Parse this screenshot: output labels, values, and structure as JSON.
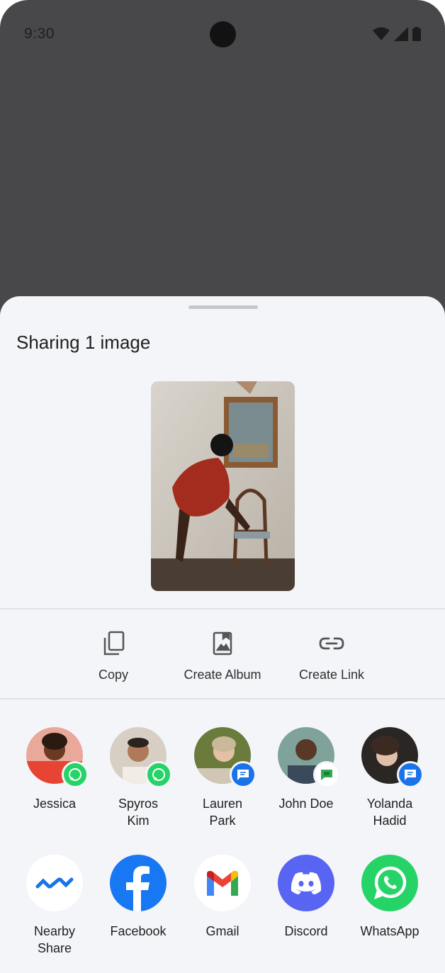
{
  "status_bar": {
    "time": "9:30"
  },
  "sheet": {
    "title": "Sharing 1 image"
  },
  "actions": [
    {
      "label": "Copy",
      "icon": "copy-icon"
    },
    {
      "label": "Create Album",
      "icon": "album-icon"
    },
    {
      "label": "Create Link",
      "icon": "link-icon"
    }
  ],
  "contacts": [
    {
      "name": "Jessica",
      "app": "WhatsApp"
    },
    {
      "name": "Spyros Kim",
      "app": "WhatsApp"
    },
    {
      "name": "Lauren Park",
      "app": "Messages"
    },
    {
      "name": "John Doe",
      "app": "Google Chat"
    },
    {
      "name": "Yolanda Hadid",
      "app": "Messages"
    }
  ],
  "apps": [
    {
      "name": "Nearby Share",
      "icon": "nearby-share-icon"
    },
    {
      "name": "Facebook",
      "icon": "facebook-icon"
    },
    {
      "name": "Gmail",
      "icon": "gmail-icon"
    },
    {
      "name": "Discord",
      "icon": "discord-icon"
    },
    {
      "name": "WhatsApp",
      "icon": "whatsapp-icon"
    }
  ],
  "colors": {
    "backdrop": "#48484a",
    "sheet": "#f4f5f9",
    "whatsapp": "#25d366",
    "messages": "#1a73e8",
    "facebook": "#1877f2",
    "discord": "#5865f2"
  }
}
